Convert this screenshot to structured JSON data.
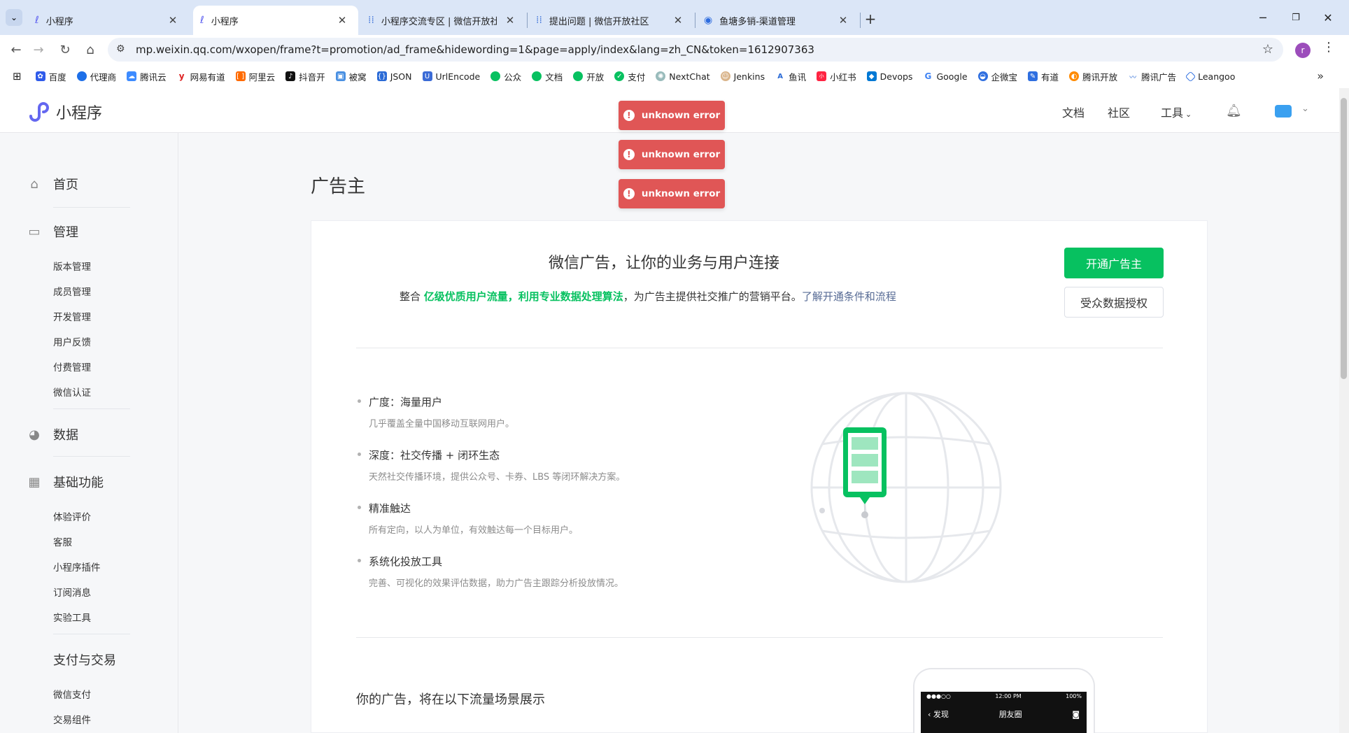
{
  "browser": {
    "tabs": [
      {
        "label": "小程序"
      },
      {
        "label": "小程序"
      },
      {
        "label": "小程序交流专区 | 微信开放社区"
      },
      {
        "label": "提出问题 | 微信开放社区"
      },
      {
        "label": "鱼塘多销-渠道管理"
      }
    ],
    "url": "mp.weixin.qq.com/wxopen/frame?t=promotion/ad_frame&hidewording=1&page=apply/index&lang=zh_CN&token=1612907363",
    "profile_initial": "r",
    "bookmarks": [
      "百度",
      "代理商",
      "腾讯云",
      "网易有道",
      "阿里云",
      "抖音开",
      "被窝",
      "JSON",
      "UrlEncode",
      "公众",
      "文档",
      "开放",
      "支付",
      "NextChat",
      "Jenkins",
      "鱼讯",
      "小红书",
      "Devops",
      "Google",
      "企微宝",
      "有道",
      "腾讯开放",
      "腾讯广告",
      "Leangoo"
    ]
  },
  "header": {
    "app_name": "小程序",
    "nav_docs": "文档",
    "nav_community": "社区",
    "nav_tools": "工具"
  },
  "sidebar": {
    "home": "首页",
    "manage": "管理",
    "manage_items": [
      "版本管理",
      "成员管理",
      "开发管理",
      "用户反馈",
      "付费管理",
      "微信认证"
    ],
    "data": "数据",
    "basic": "基础功能",
    "basic_items": [
      "体验评价",
      "客服",
      "小程序插件",
      "订阅消息",
      "实验工具"
    ],
    "pay": "支付与交易",
    "pay_items": [
      "微信支付",
      "交易组件"
    ]
  },
  "main": {
    "page_title": "广告主",
    "hero_title": "微信广告，让你的业务与用户连接",
    "hero_desc_prefix": "整合 ",
    "hero_desc_highlight": "亿级优质用户流量，利用专业数据处理算法",
    "hero_desc_suffix": "，为广告主提供社交推广的营销平台。",
    "hero_desc_link": "了解开通条件和流程",
    "btn_open": "开通广告主",
    "btn_auth": "受众数据授权",
    "features": [
      {
        "title": "广度：海量用户",
        "desc": "几乎覆盖全量中国移动互联网用户。"
      },
      {
        "title": "深度：社交传播 + 闭环生态",
        "desc": "天然社交传播环境，提供公众号、卡券、LBS 等闭环解决方案。"
      },
      {
        "title": "精准触达",
        "desc": "所有定向，以人为单位，有效触达每一个目标用户。"
      },
      {
        "title": "系统化投放工具",
        "desc": "完善、可视化的效果评估数据，助力广告主跟踪分析投放情况。"
      }
    ],
    "section2_title": "你的广告，将在以下流量场景展示",
    "phone_time": "12:00 PM",
    "phone_battery": "100%",
    "phone_back": "发现",
    "phone_title": "朋友圈"
  },
  "toasts": [
    "unknown error",
    "unknown error",
    "unknown error"
  ],
  "colors": {
    "brand_green": "#07c160",
    "link": "#576b95",
    "toast": "#e05656"
  }
}
